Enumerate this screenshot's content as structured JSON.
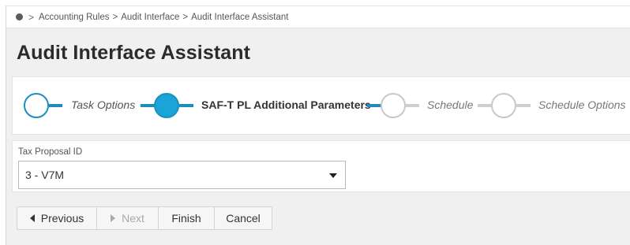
{
  "breadcrumb": {
    "items": [
      "Accounting Rules",
      "Audit Interface"
    ],
    "current": "Audit Interface Assistant"
  },
  "page": {
    "title": "Audit Interface Assistant"
  },
  "wizard": {
    "steps": [
      {
        "label": "Task Options",
        "state": "done"
      },
      {
        "label": "SAF-T PL Additional Parameters",
        "state": "active"
      },
      {
        "label": "Schedule",
        "state": "future"
      },
      {
        "label": "Schedule Options",
        "state": "future"
      }
    ]
  },
  "form": {
    "tax_proposal": {
      "label": "Tax Proposal ID",
      "value": "3 - V7M"
    }
  },
  "buttons": {
    "previous": "Previous",
    "next": "Next",
    "finish": "Finish",
    "cancel": "Cancel"
  },
  "colors": {
    "accent": "#1b8fbc",
    "active_fill": "#1ba4d8",
    "inactive": "#c8c8c8"
  }
}
